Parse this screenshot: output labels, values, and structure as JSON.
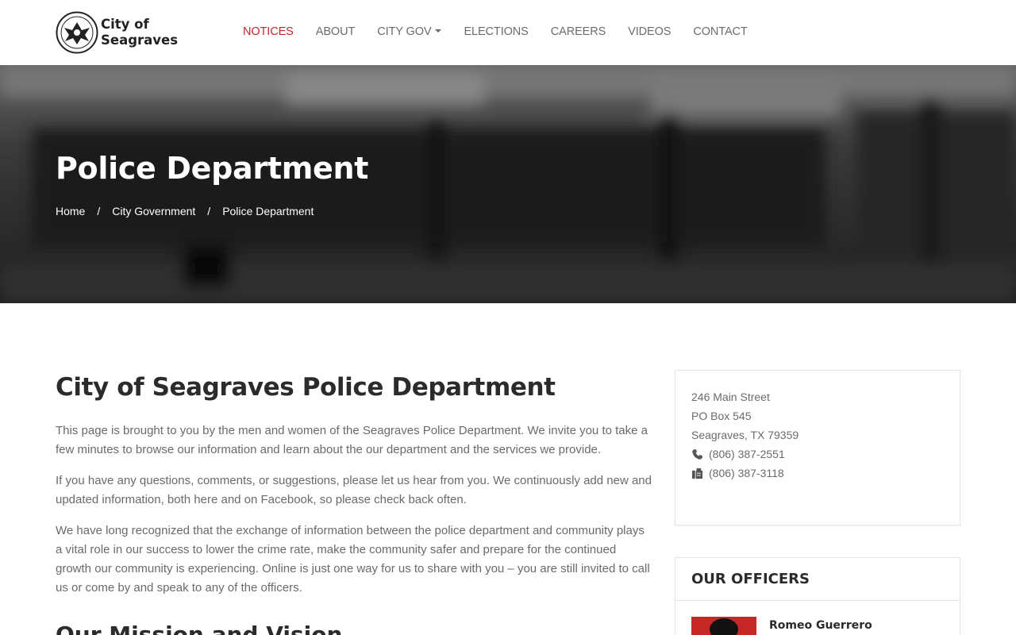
{
  "header": {
    "logo_text": "City of Seagraves",
    "logo_line1": "City of",
    "logo_line2": "Seagraves",
    "nav": [
      {
        "label": "NOTICES",
        "active": true
      },
      {
        "label": "ABOUT"
      },
      {
        "label": "CITY GOV",
        "dropdown": true
      },
      {
        "label": "ELECTIONS"
      },
      {
        "label": "CAREERS"
      },
      {
        "label": "VIDEOS"
      },
      {
        "label": "CONTACT"
      }
    ]
  },
  "hero": {
    "title": "Police Department",
    "breadcrumb": [
      {
        "label": "Home"
      },
      {
        "label": "City Government"
      },
      {
        "label": "Police Department"
      }
    ],
    "separator": "/"
  },
  "main": {
    "title": "City of Seagraves Police Department",
    "paragraphs": [
      "This page is brought to you by the men and women of the Seagraves Police Department. We invite you to take a few minutes to browse our information and learn about the our department and the services we provide.",
      "If you have any questions, comments, or suggestions, please let us hear from you. We continuously add new and updated information, both here and on Facebook, so please check back often.",
      "We have long recognized that the exchange of information between the police department and community plays a vital role in our success to lower the crime rate, make the community safer and prepare for the continued growth our community is experiencing. Online is just one way for us to share with you – you are still invited to call us or come by and speak to any of the officers."
    ],
    "next_section_title": "Our Mission and Vision"
  },
  "sidebar": {
    "contact": {
      "address_line1": "246 Main Street",
      "address_line2": "PO Box 545",
      "address_line3": "Seagraves, TX 79359",
      "phone": "(806) 387-2551",
      "fax": "(806) 387-3118"
    },
    "officers": {
      "title": "OUR OFFICERS",
      "first_officer_name": "Romeo Guerrero"
    }
  },
  "colors": {
    "accent": "#c0272d",
    "nav_text": "#6b6b6b",
    "body_text": "#6a6a6a",
    "heading": "#2b2b2b"
  },
  "icons": {
    "phone": "phone-icon",
    "fax": "fax-icon",
    "dropdown": "chevron-down-icon",
    "seal": "city-seal-logo"
  }
}
